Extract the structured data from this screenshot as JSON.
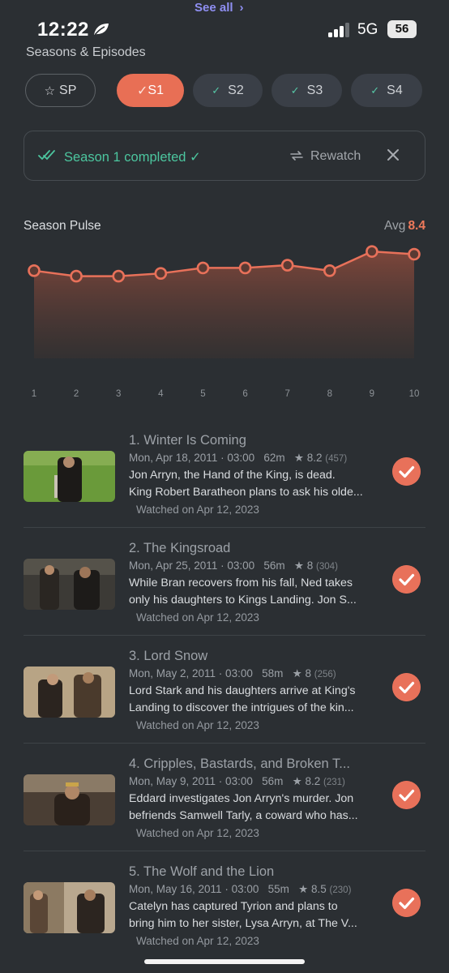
{
  "status": {
    "time": "12:22",
    "network": "5G",
    "battery": "56",
    "see_all": "See all"
  },
  "section_title": "Seasons & Episodes",
  "seasons": [
    {
      "label": "SP",
      "state": "special"
    },
    {
      "label": "S1",
      "state": "active"
    },
    {
      "label": "S2",
      "state": "completed"
    },
    {
      "label": "S3",
      "state": "completed"
    },
    {
      "label": "S4",
      "state": "completed"
    }
  ],
  "completion": {
    "text": "Season 1 completed ✓",
    "rewatch_label": "Rewatch"
  },
  "pulse": {
    "title": "Season Pulse",
    "avg_label": "Avg",
    "avg_value": "8.4"
  },
  "chart_data": {
    "type": "area",
    "x": [
      1,
      2,
      3,
      4,
      5,
      6,
      7,
      8,
      9,
      10
    ],
    "tick_labels": [
      "1",
      "2",
      "3",
      "4",
      "5",
      "6",
      "7",
      "8",
      "9",
      "10"
    ],
    "values": [
      8.2,
      8.0,
      8.0,
      8.1,
      8.3,
      8.3,
      8.4,
      8.2,
      8.9,
      8.8
    ],
    "color": "#e8715a"
  },
  "episodes": [
    {
      "title": "1. Winter Is Coming",
      "date": "Mon, Apr 18, 2011 · 03:00",
      "runtime": "62m",
      "rating": "★ 8.2",
      "votes": "(457)",
      "desc_line1": "Jon Arryn, the Hand of the King, is dead.",
      "desc_line2": "King Robert Baratheon plans to ask his olde...",
      "watched": "Watched on Apr 12, 2023"
    },
    {
      "title": "2. The Kingsroad",
      "date": "Mon, Apr 25, 2011 · 03:00",
      "runtime": "56m",
      "rating": "★ 8",
      "votes": "(304)",
      "desc_line1": "While Bran recovers from his fall, Ned takes",
      "desc_line2": "only his daughters to Kings Landing. Jon S...",
      "watched": "Watched on Apr 12, 2023"
    },
    {
      "title": "3. Lord Snow",
      "date": "Mon, May 2, 2011 · 03:00",
      "runtime": "58m",
      "rating": "★ 8",
      "votes": "(256)",
      "desc_line1": "Lord Stark and his daughters arrive at King's",
      "desc_line2": "Landing to discover the intrigues of the kin...",
      "watched": "Watched on Apr 12, 2023"
    },
    {
      "title": "4. Cripples, Bastards, and Broken T...",
      "date": "Mon, May 9, 2011 · 03:00",
      "runtime": "56m",
      "rating": "★ 8.2",
      "votes": "(231)",
      "desc_line1": "Eddard investigates Jon Arryn's murder. Jon",
      "desc_line2": "befriends Samwell Tarly, a coward who has...",
      "watched": "Watched on Apr 12, 2023"
    },
    {
      "title": "5. The Wolf and the Lion",
      "date": "Mon, May 16, 2011 · 03:00",
      "runtime": "55m",
      "rating": "★ 8.5",
      "votes": "(230)",
      "desc_line1": "Catelyn has captured Tyrion and plans to",
      "desc_line2": "bring him to her sister, Lysa Arryn, at The V...",
      "watched": "Watched on Apr 12, 2023"
    }
  ]
}
